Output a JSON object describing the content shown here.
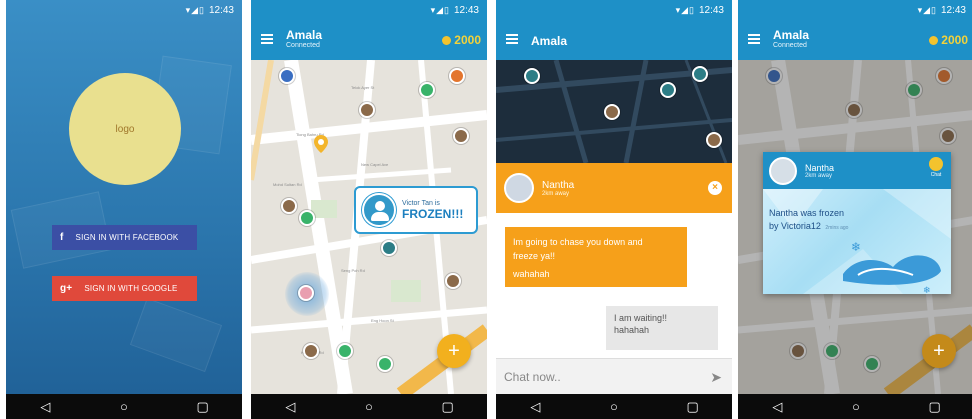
{
  "status": {
    "time": "12:43",
    "icons": "▾◢▯"
  },
  "nav": {
    "back": "◁",
    "home": "○",
    "recents": "▢"
  },
  "login": {
    "logo_text": "logo",
    "facebook_label": "SIGN IN WITH FACEBOOK",
    "google_label": "SIGN IN WITH GOOGLE",
    "facebook_glyph": "f",
    "google_glyph": "g+"
  },
  "map_screen": {
    "title": "Amala",
    "subtitle": "Connected",
    "coins": "2000",
    "frozen_line1": "Victor Tan is",
    "frozen_line2": "FROZEN!!!",
    "fab": "+",
    "streets": [
      "Tiong Bahru Rd",
      "Telok Ayer St",
      "Kim Seng Rd",
      "Jln Bukit Merah",
      "Eng Hoon St",
      "New Capel Ave",
      "Mohd Sultan Rd",
      "Tiong Bahru Plaza",
      "Seng Poh Rd",
      "Havelock Rd",
      "Lim Liak St",
      "Yong Siak St"
    ]
  },
  "chat_screen": {
    "title": "Amala",
    "contact_name": "Nantha",
    "contact_distance": "2km away",
    "close": "×",
    "incoming_line1": "Im going to chase you down and",
    "incoming_line2": "freeze ya!!",
    "incoming_line3": "wahahah",
    "outgoing_line1": "I am waiting!!",
    "outgoing_line2": "hahahah",
    "input_placeholder": "Chat now..",
    "send_icon": "➤"
  },
  "notice_screen": {
    "title": "Amala",
    "subtitle": "Connected",
    "coins": "2000",
    "name": "Nantha",
    "distance": "2km away",
    "chat_label": "Chat",
    "message_line1": "Nantha was frozen",
    "message_line2": "by Victoria12",
    "time": "2mins ago",
    "fab": "+"
  },
  "colors": {
    "primary": "#1e90c7",
    "accent": "#f6a01a",
    "coin": "#f3c32e",
    "facebook": "#3b4fa5",
    "google": "#e0493b"
  }
}
